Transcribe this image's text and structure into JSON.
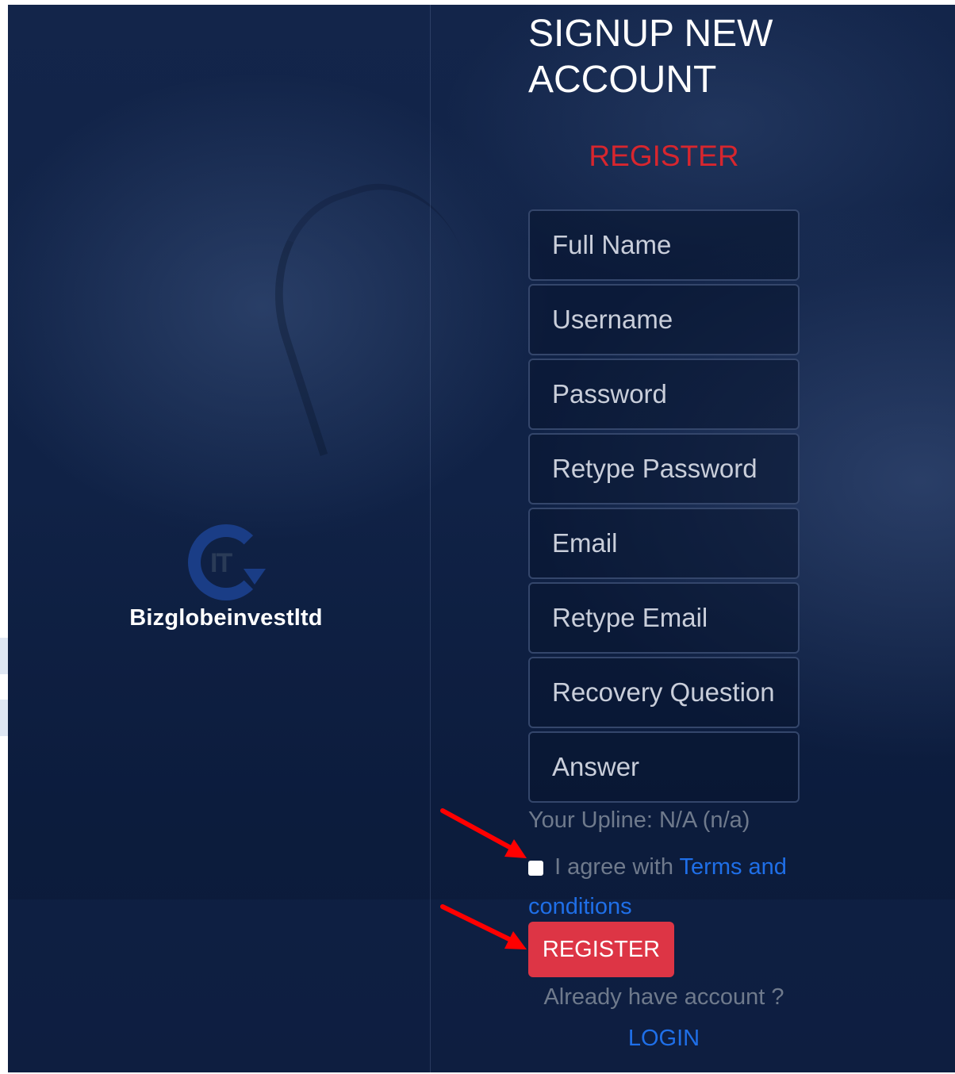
{
  "form": {
    "title": "SIGNUP NEW ACCOUNT",
    "subtitle": "REGISTER",
    "fields": {
      "full_name": "Full Name",
      "username": "Username",
      "password": "Password",
      "retype_password": "Retype Password",
      "email": "Email",
      "retype_email": "Retype Email",
      "recovery_question": "Recovery Question",
      "answer": "Answer"
    },
    "upline": "Your Upline: N/A (n/a)",
    "agree_text": "I agree with",
    "terms_link": "Terms and conditions",
    "register_button": "REGISTER",
    "already_text": "Already have account ?",
    "login_link": "LOGIN"
  },
  "brand": {
    "name": "Bizglobeinvestltd",
    "logo_letters": "IT"
  },
  "colors": {
    "background": "#102246",
    "accent_red": "#dd3545",
    "link_blue": "#1f6fe8",
    "annotation_arrow": "#ff0000"
  },
  "icons": {
    "logo": "globe-swirl-logo",
    "annotation": "red-arrow"
  }
}
